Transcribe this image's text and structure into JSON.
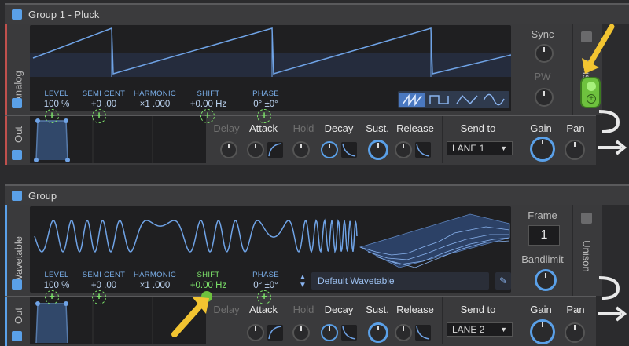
{
  "group1": {
    "title": "Group 1 - Pluck",
    "osc_label": "Analog",
    "params": [
      {
        "label": "LEVEL",
        "value": "100 %"
      },
      {
        "label": "SEMI CENT",
        "value": "+0 .00"
      },
      {
        "label": "HARMONIC",
        "value": "×1 .000"
      },
      {
        "label": "SHIFT",
        "value": "+0.00 Hz"
      },
      {
        "label": "PHASE",
        "value": "0° ±0°"
      }
    ],
    "sync_label": "Sync",
    "pw_label": "PW",
    "unison_label": "Unison",
    "waveform_buttons": [
      "saw-icon",
      "square-icon",
      "triangle-icon",
      "sine-icon"
    ]
  },
  "out1": {
    "label": "Out",
    "env": [
      "Delay",
      "Attack",
      "Hold",
      "Decay",
      "Sust.",
      "Release"
    ],
    "send_to_label": "Send to",
    "lane": "LANE 1",
    "gain_label": "Gain",
    "pan_label": "Pan"
  },
  "group2": {
    "title": "Group",
    "osc_label": "Wavetable",
    "params": [
      {
        "label": "LEVEL",
        "value": "100 %"
      },
      {
        "label": "SEMI CENT",
        "value": "+0 .00"
      },
      {
        "label": "HARMONIC",
        "value": "×1 .000"
      },
      {
        "label": "SHIFT",
        "value": "+0.00 Hz"
      },
      {
        "label": "PHASE",
        "value": "0° ±0°"
      }
    ],
    "wavetable_name": "Default Wavetable",
    "frame_label": "Frame",
    "frame_value": "1",
    "bandlimit_label": "Bandlimit",
    "unison_label": "Unison"
  },
  "out2": {
    "label": "Out",
    "env": [
      "Delay",
      "Attack",
      "Hold",
      "Decay",
      "Sust.",
      "Release"
    ],
    "send_to_label": "Send to",
    "lane": "LANE 2",
    "gain_label": "Gain",
    "pan_label": "Pan"
  },
  "colors": {
    "accent": "#5aa0e8",
    "mod_green": "#7de36a",
    "annotation_yellow": "#f2c431",
    "strip_red": "#c0504d"
  }
}
